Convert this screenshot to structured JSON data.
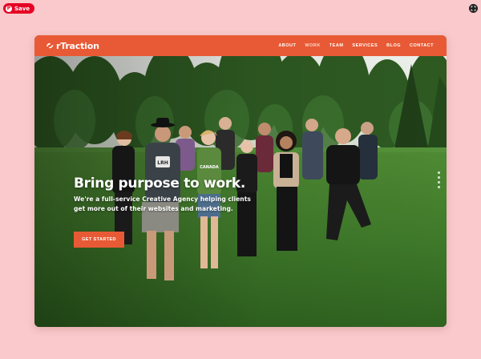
{
  "overlay": {
    "save_label": "Save",
    "pin_glyph": "P"
  },
  "navbar": {
    "logo_text": "rTraction",
    "links": [
      {
        "label": "ABOUT"
      },
      {
        "label": "WORK"
      },
      {
        "label": "TEAM"
      },
      {
        "label": "SERVICES"
      },
      {
        "label": "BLOG"
      },
      {
        "label": "CONTACT"
      }
    ],
    "active_link": "WORK"
  },
  "hero": {
    "headline": "Bring purpose to work.",
    "subhead": "We're a full-service Creative Agency helping clients get more out of their websites and marketing.",
    "cta_label": "GET STARTED",
    "shirt_text": "LRH",
    "shirt_text_2": "CANADA"
  },
  "colors": {
    "accent": "#e85a35",
    "background": "#f9c9cb",
    "pinterest_red": "#e60023"
  },
  "icons": {
    "save": "pin-icon",
    "corner": "expand-icon",
    "logo": "logo-mark-icon"
  }
}
